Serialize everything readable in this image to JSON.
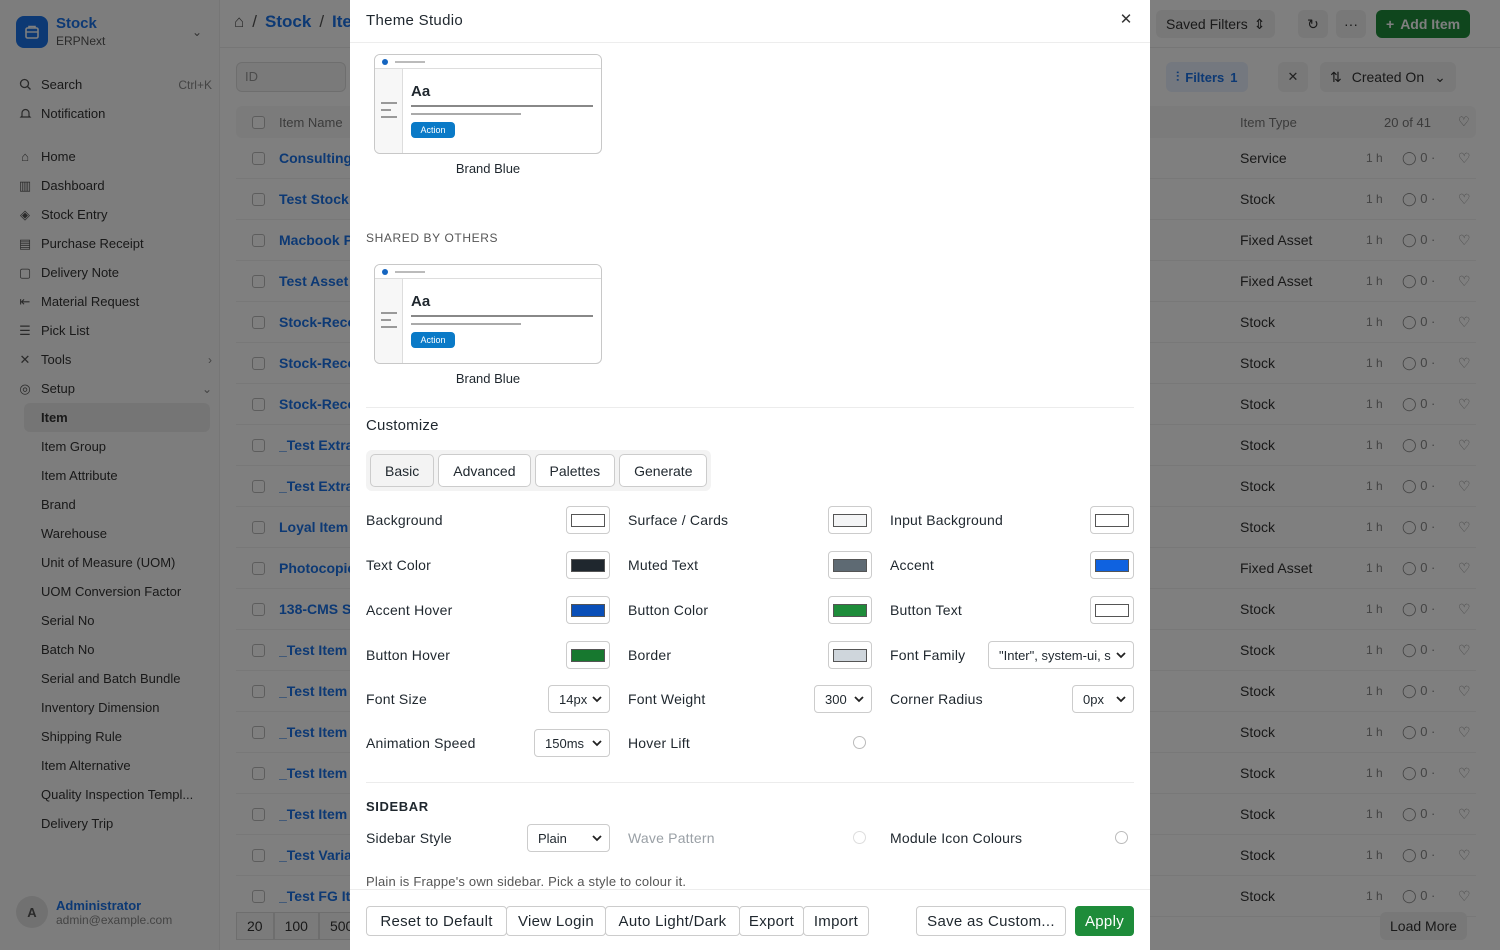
{
  "app": {
    "title": "Stock",
    "subtitle": "ERPNext",
    "brand_color": "#1a73e8"
  },
  "sidebar": {
    "top_items": [
      {
        "label": "Search",
        "shortcut": "Ctrl+K",
        "icon": "search-icon"
      },
      {
        "label": "Notification",
        "icon": "bell-icon"
      }
    ],
    "items": [
      {
        "label": "Home",
        "icon": "home-icon"
      },
      {
        "label": "Dashboard",
        "icon": "chart-icon"
      },
      {
        "label": "Stock Entry",
        "icon": "box-icon"
      },
      {
        "label": "Purchase Receipt",
        "icon": "receipt-icon"
      },
      {
        "label": "Delivery Note",
        "icon": "note-icon"
      },
      {
        "label": "Material Request",
        "icon": "arrow-icon"
      },
      {
        "label": "Pick List",
        "icon": "list-icon"
      },
      {
        "label": "Tools",
        "icon": "tools-icon"
      },
      {
        "label": "Setup",
        "icon": "setup-icon"
      }
    ],
    "setup_items": [
      "Item",
      "Item Group",
      "Item Attribute",
      "Brand",
      "Warehouse",
      "Unit of Measure (UOM)",
      "UOM Conversion Factor",
      "Serial No",
      "Batch No",
      "Serial and Batch Bundle",
      "Inventory Dimension",
      "Shipping Rule",
      "Item Alternative",
      "Quality Inspection Templ...",
      "Delivery Trip"
    ],
    "user": {
      "initial": "A",
      "name": "Administrator",
      "email": "admin@example.com"
    }
  },
  "topbar": {
    "breadcrumb": [
      "Stock",
      "Ite"
    ],
    "saved_filters": "Saved Filters",
    "add_item": "Add Item"
  },
  "list": {
    "id_placeholder": "ID",
    "filters_label": "Filters",
    "filters_count": "1",
    "sort_label": "Created On",
    "header_name": "Item Name",
    "header_type": "Item Type",
    "count": "20 of 41",
    "rows": [
      {
        "name": "Consulting",
        "type": "Service"
      },
      {
        "name": "Test Stock",
        "type": "Stock"
      },
      {
        "name": "Macbook P",
        "type": "Fixed Asset"
      },
      {
        "name": "Test Asset",
        "type": "Fixed Asset"
      },
      {
        "name": "Stock-Reco",
        "type": "Stock"
      },
      {
        "name": "Stock-Reco",
        "type": "Stock"
      },
      {
        "name": "Stock-Reco",
        "type": "Stock"
      },
      {
        "name": "_Test Extra",
        "type": "Stock"
      },
      {
        "name": "_Test Extra",
        "type": "Stock"
      },
      {
        "name": "Loyal Item",
        "type": "Stock"
      },
      {
        "name": "Photocopie",
        "type": "Fixed Asset"
      },
      {
        "name": "138-CMS S",
        "type": "Stock"
      },
      {
        "name": "_Test Item",
        "type": "Stock"
      },
      {
        "name": "_Test Item",
        "type": "Stock"
      },
      {
        "name": "_Test Item",
        "type": "Stock"
      },
      {
        "name": "_Test Item",
        "type": "Stock"
      },
      {
        "name": "_Test Item",
        "type": "Stock"
      },
      {
        "name": "_Test Varia",
        "type": "Stock"
      },
      {
        "name": "_Test FG Ite",
        "type": "Stock"
      }
    ],
    "row_time": "1 h",
    "row_comments": "0",
    "page_sizes": [
      "20",
      "100",
      "500"
    ],
    "load_more": "Load More"
  },
  "modal": {
    "title": "Theme Studio",
    "my_theme": {
      "name": "Brand Blue",
      "sample": "Aa",
      "button": "Action"
    },
    "shared_label": "SHARED BY OTHERS",
    "shared_theme": {
      "name": "Brand Blue",
      "sample": "Aa",
      "button": "Action"
    },
    "customize_label": "Customize",
    "tabs": [
      "Basic",
      "Advanced",
      "Palettes",
      "Generate"
    ],
    "colors": {
      "background": {
        "label": "Background",
        "value": "#ffffff"
      },
      "surface": {
        "label": "Surface / Cards",
        "value": "#f4f5f6"
      },
      "input_bg": {
        "label": "Input Background",
        "value": "#ffffff"
      },
      "text": {
        "label": "Text Color",
        "value": "#1f272e"
      },
      "muted": {
        "label": "Muted Text",
        "value": "#5e6a73"
      },
      "accent": {
        "label": "Accent",
        "value": "#0f62e0"
      },
      "accent_hover": {
        "label": "Accent Hover",
        "value": "#0a4fb8"
      },
      "button": {
        "label": "Button Color",
        "value": "#1e8c3a"
      },
      "button_text": {
        "label": "Button Text",
        "value": "#ffffff"
      },
      "button_hover": {
        "label": "Button Hover",
        "value": "#17782f"
      },
      "border": {
        "label": "Border",
        "value": "#cfd6dc"
      }
    },
    "font_family": {
      "label": "Font Family",
      "value": "\"Inter\", system-ui, s"
    },
    "font_size": {
      "label": "Font Size",
      "value": "14px"
    },
    "font_weight": {
      "label": "Font Weight",
      "value": "300"
    },
    "corner_radius": {
      "label": "Corner Radius",
      "value": "0px"
    },
    "animation_speed": {
      "label": "Animation Speed",
      "value": "150ms"
    },
    "hover_lift": {
      "label": "Hover Lift"
    },
    "sidebar_section": "SIDEBAR",
    "sidebar_style": {
      "label": "Sidebar Style",
      "value": "Plain"
    },
    "wave_pattern": {
      "label": "Wave Pattern"
    },
    "module_icons": {
      "label": "Module Icon Colours"
    },
    "hint": "Plain is Frappe's own sidebar. Pick a style to colour it.",
    "footer": {
      "reset": "Reset to Default",
      "view_login": "View Login",
      "auto": "Auto Light/Dark",
      "export": "Export",
      "import": "Import",
      "save_custom": "Save as Custom...",
      "apply": "Apply"
    }
  }
}
